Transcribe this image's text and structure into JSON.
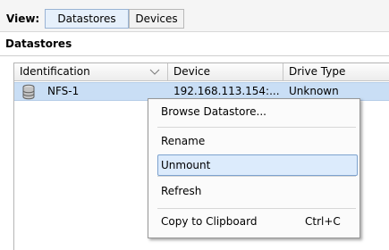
{
  "view": {
    "label": "View:",
    "options": [
      "Datastores",
      "Devices"
    ],
    "selected": "Datastores"
  },
  "section": {
    "title": "Datastores"
  },
  "table": {
    "columns": [
      "Identification",
      "Device",
      "Drive Type"
    ],
    "rows": [
      {
        "identification": "NFS-1",
        "device": "192.168.113.154:...",
        "drive_type": "Unknown",
        "icon": "datastore-icon",
        "selected": true
      }
    ]
  },
  "context_menu": {
    "items": [
      {
        "label": "Browse Datastore...",
        "shortcut": ""
      },
      {
        "label": "Rename",
        "shortcut": ""
      },
      {
        "label": "Unmount",
        "shortcut": "",
        "highlighted": true
      },
      {
        "label": "Refresh",
        "shortcut": ""
      },
      {
        "label": "Copy to Clipboard",
        "shortcut": "Ctrl+C"
      }
    ]
  },
  "colors": {
    "selection_row": "#c9def5",
    "menu_highlight": "#dcebfc",
    "menu_highlight_border": "#7da2ce"
  }
}
